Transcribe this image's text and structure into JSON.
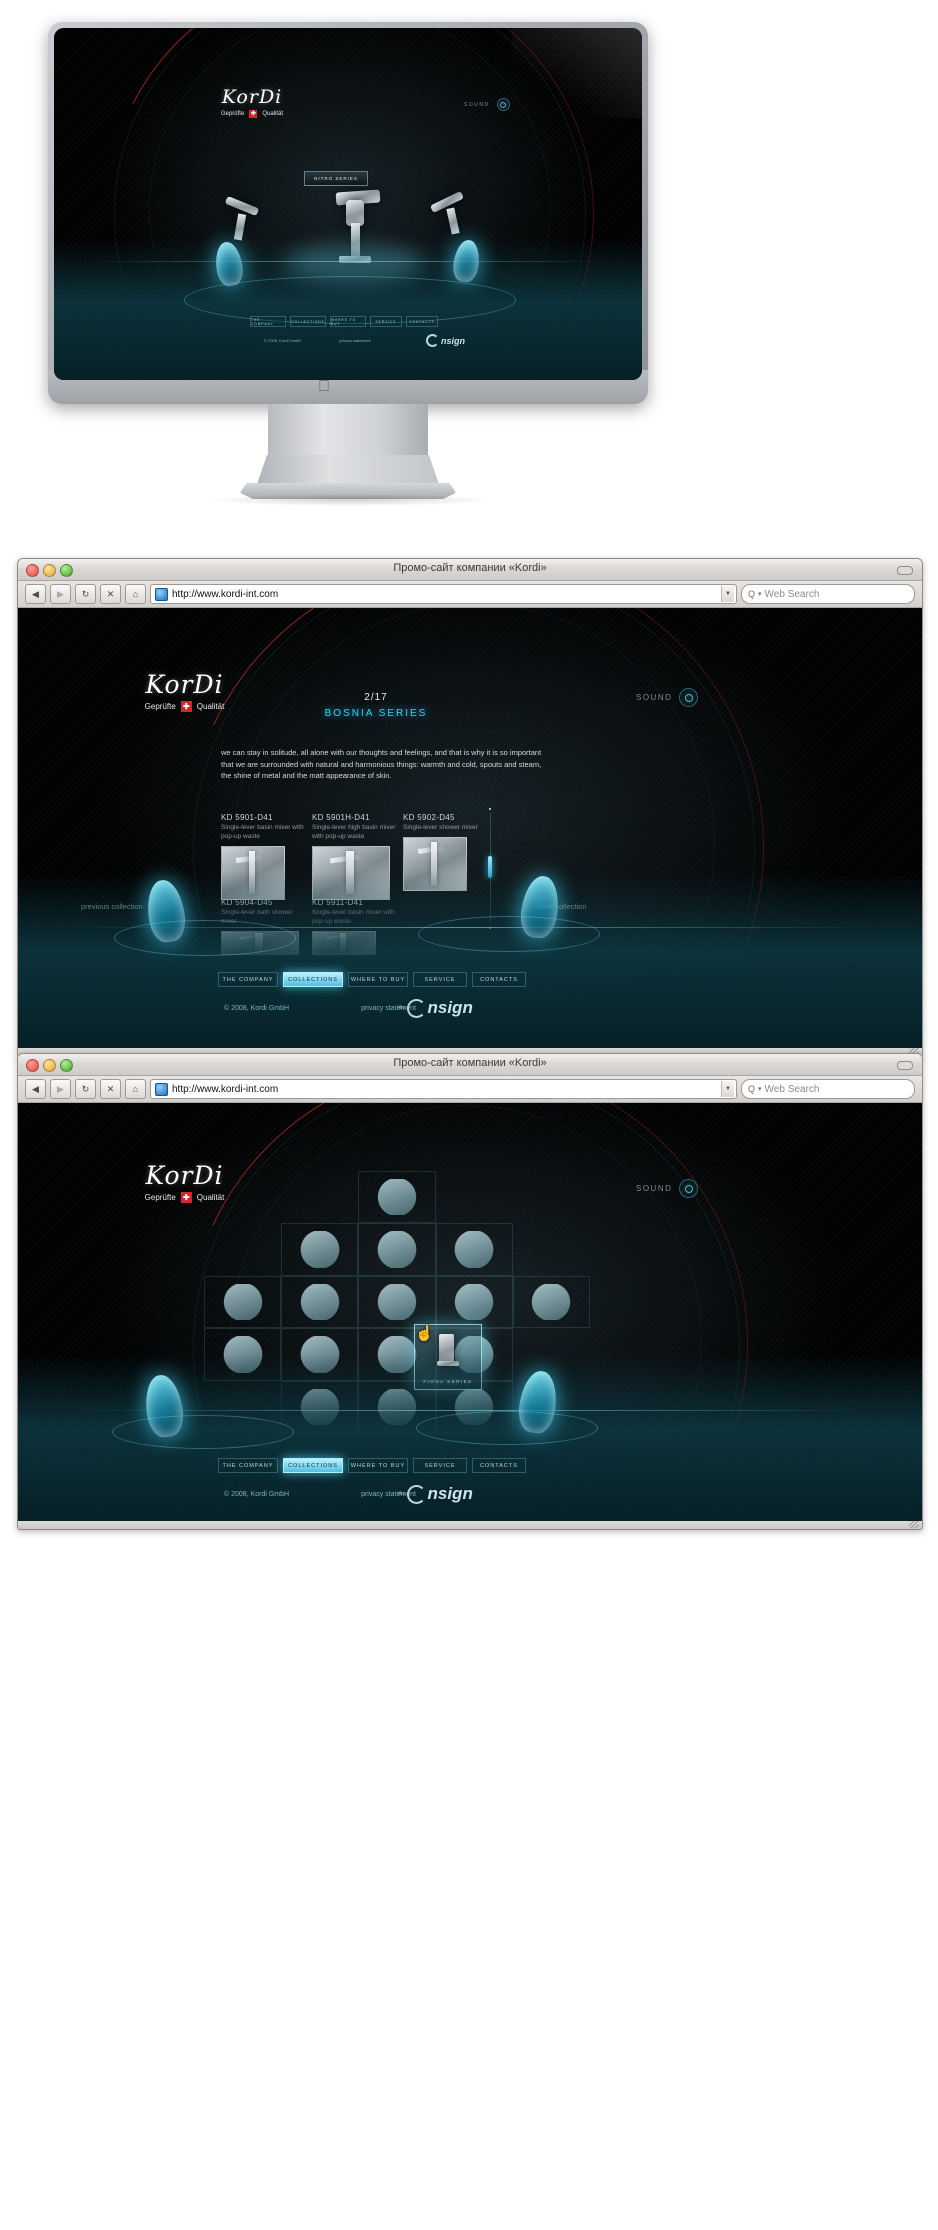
{
  "site": {
    "logo": {
      "name": "KorDi",
      "tagline_left": "Geprüfte",
      "tagline_right": "Qualität",
      "swiss_mark": "✚"
    },
    "sound": {
      "label": "SOUND"
    },
    "nav": [
      {
        "label": "THE COMPANY",
        "active": false
      },
      {
        "label": "COLLECTIONS",
        "active": true
      },
      {
        "label": "WHERE TO BUY",
        "active": false
      },
      {
        "label": "SERVICE",
        "active": false
      },
      {
        "label": "CONTACTS",
        "active": false
      }
    ],
    "footer": {
      "copyright": "© 2008, Kordi GmbH",
      "privacy": "privacy statement",
      "agency": "nsign",
      "agency_prefix": "the"
    }
  },
  "monitor": {
    "badge": "NITRO SERIES",
    "nav": [
      "THE COMPANY",
      "COLLECTIONS",
      "WHERE TO BUY",
      "SERVICE",
      "CONTACTS"
    ],
    "footer_copyright": "© 2008, Kordi GmbH",
    "footer_privacy": "privacy statement",
    "sound_label": "SOUND",
    "agency": "nsign"
  },
  "window_collection": {
    "title": "Промо-сайт компании «Kordi»",
    "toolbar": {
      "back": "◀",
      "forward": "▶",
      "reload": "↻",
      "stop": "✕",
      "home": "⌂",
      "url": "http://www.kordi-int.com",
      "search_placeholder": "Web Search",
      "search_icon": "Q"
    },
    "page_counter": "2/17",
    "series": "BOSNIA SERIES",
    "intro": "we can stay in solitude, all alone with our thoughts and feelings, and that is why it is so important that we are surrounded with natural and harmonious things: warmth and cold, spouts and steam, the shine of metal and the matt appearance of skin.",
    "prev_link": "previous collection",
    "next_link": "next collection",
    "products": [
      {
        "code": "KD 5901-D41",
        "desc": "Single-lever basin mixer with pop-up waste"
      },
      {
        "code": "KD 5901H-D41",
        "desc": "Single-lever high basin mixer with pop-up waste"
      },
      {
        "code": "KD 5902-D45",
        "desc": "Single-lever shower mixer"
      },
      {
        "code": "KD 5904-D45",
        "desc": "Single-lever bath shower mixer"
      },
      {
        "code": "KD 5911-D41",
        "desc": "Single-lever basin mixer with pop-up waste"
      }
    ]
  },
  "window_grid": {
    "title": "Промо-сайт компании «Kordi»",
    "toolbar": {
      "back": "◀",
      "forward": "▶",
      "reload": "↻",
      "stop": "✕",
      "home": "⌂",
      "url": "http://www.kordi-int.com",
      "search_placeholder": "Web Search",
      "search_icon": "Q"
    },
    "tooltip_label": "FIONA SERIES",
    "cursor_icon": "pointer-hand-icon"
  },
  "colors": {
    "accent_cyan": "#35d2f5",
    "accent_red": "#be281e",
    "site_bg": "#000000",
    "swiss_red": "#d8232a"
  }
}
